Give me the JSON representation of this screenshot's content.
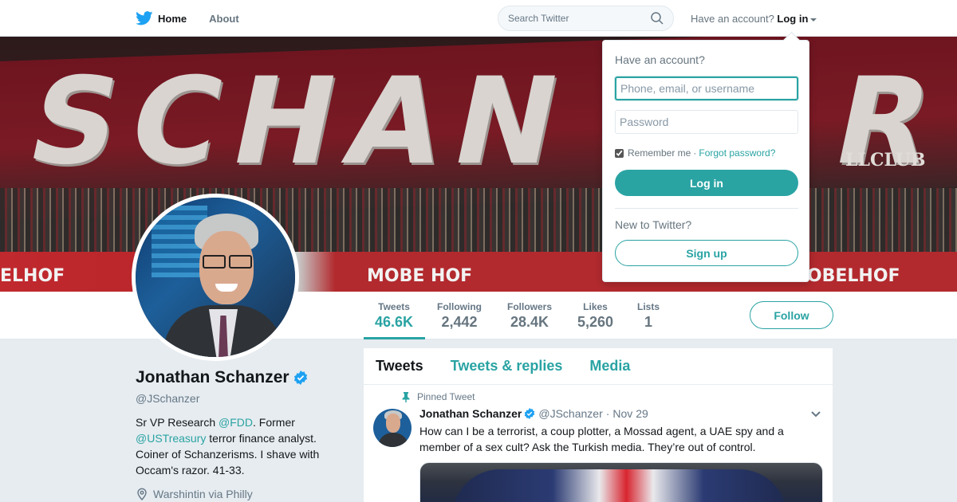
{
  "nav": {
    "home_label": "Home",
    "about_label": "About",
    "search_placeholder": "Search Twitter",
    "have_account_label": "Have an account?",
    "login_label": "Log in"
  },
  "banner": {
    "letters": "SCHAN",
    "letters_right": "R",
    "club_text": "LLCLUB",
    "ad_texts": [
      "ELHOF",
      "MOBE HOF",
      "MOBELHOF"
    ]
  },
  "stats": [
    {
      "label": "Tweets",
      "value": "46.6K"
    },
    {
      "label": "Following",
      "value": "2,442"
    },
    {
      "label": "Followers",
      "value": "28.4K"
    },
    {
      "label": "Likes",
      "value": "5,260"
    },
    {
      "label": "Lists",
      "value": "1"
    }
  ],
  "follow_label": "Follow",
  "profile": {
    "name": "Jonathan Schanzer",
    "handle": "@JSchanzer",
    "bio_1": "Sr VP Research ",
    "bio_link_1": "@FDD",
    "bio_2": ". Former ",
    "bio_link_2": "@USTreasury",
    "bio_3": " terror finance analyst. Coiner of Schanzerisms. I shave with Occam's razor. 41-33.",
    "location": "Warshintin via Philly"
  },
  "timeline": {
    "tabs": [
      "Tweets",
      "Tweets & replies",
      "Media"
    ],
    "pinned_label": "Pinned Tweet",
    "tweet": {
      "name": "Jonathan Schanzer",
      "handle": "@JSchanzer",
      "date": "Nov 29",
      "text": "How can I be a  terrorist, a coup plotter, a Mossad agent, a UAE spy and a member of a sex cult? Ask the Turkish media. They’re out of control."
    }
  },
  "login_dropdown": {
    "title": "Have an account?",
    "username_placeholder": "Phone, email, or username",
    "password_placeholder": "Password",
    "remember_label": "Remember me",
    "separator": "·",
    "forgot_label": "Forgot password?",
    "login_button": "Log in",
    "new_label": "New to Twitter?",
    "signup_button": "Sign up"
  },
  "colors": {
    "accent": "#2aa3a3",
    "twitter_blue": "#1da1f2",
    "verified": "#1da1f2"
  }
}
